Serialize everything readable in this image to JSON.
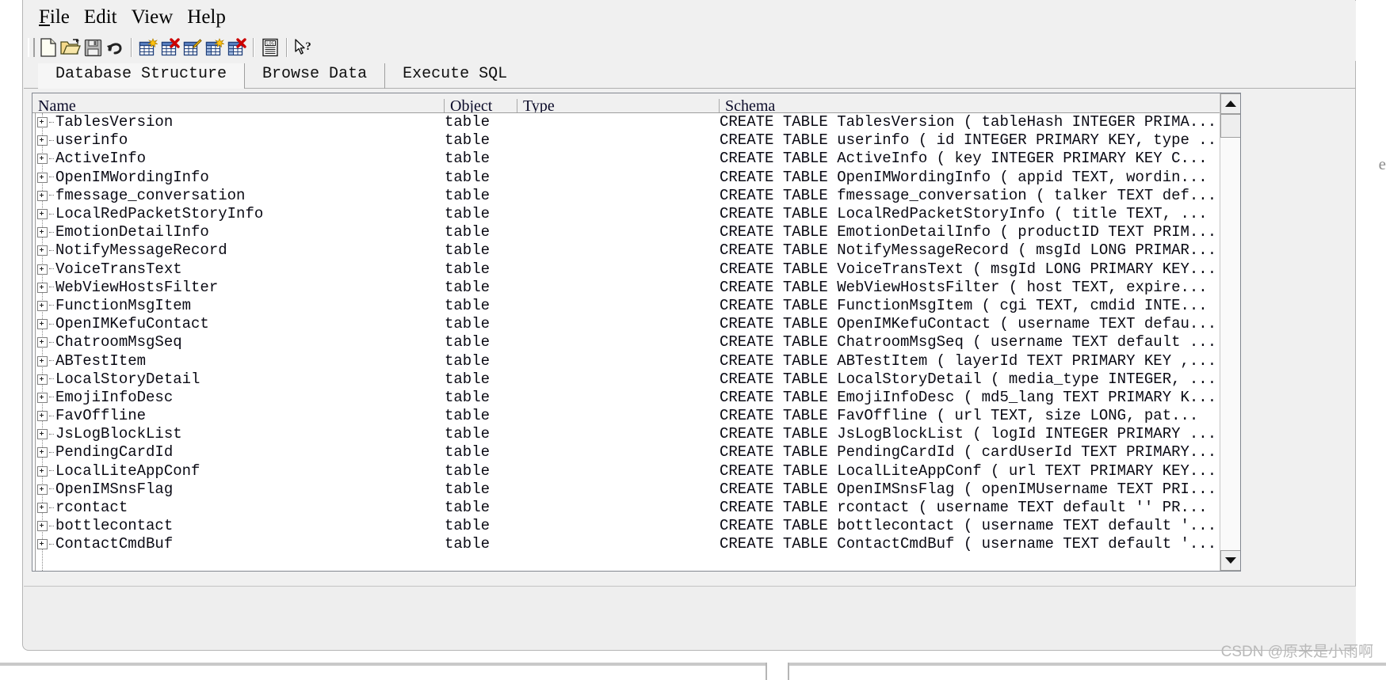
{
  "window": {
    "title_bleed": "aaaaaa aaaaa aaa",
    "right_edge_bleed": "e"
  },
  "menubar": {
    "items": [
      {
        "name": "file-menu",
        "mnemonic": "F",
        "rest": "ile"
      },
      {
        "name": "edit-menu",
        "mnemonic": "E",
        "rest": "dit"
      },
      {
        "name": "view-menu",
        "mnemonic": "V",
        "rest": "iew"
      },
      {
        "name": "help-menu",
        "mnemonic": "H",
        "rest": "elp"
      }
    ]
  },
  "toolbar": {
    "buttons": [
      {
        "icon": "new-database-icon",
        "label": "New Database"
      },
      {
        "icon": "open-database-icon",
        "label": "Open Database"
      },
      {
        "icon": "save-icon",
        "label": "Write Changes"
      },
      {
        "icon": "undo-icon",
        "label": "Revert Changes"
      },
      {
        "icon": "create-table-icon",
        "label": "Create Table"
      },
      {
        "icon": "delete-table-icon",
        "label": "Delete Table"
      },
      {
        "icon": "modify-table-icon",
        "label": "Modify Table"
      },
      {
        "icon": "create-index-icon",
        "label": "Create Index"
      },
      {
        "icon": "delete-index-icon",
        "label": "Delete Index"
      },
      {
        "icon": "log-icon",
        "label": "SQL Log"
      },
      {
        "icon": "whats-this-icon",
        "label": "What's This?"
      }
    ]
  },
  "tabs": [
    {
      "label": "Database Structure",
      "active": true
    },
    {
      "label": "Browse Data",
      "active": false
    },
    {
      "label": "Execute SQL",
      "active": false
    }
  ],
  "table": {
    "columns": [
      "Name",
      "Object",
      "Type",
      "Schema"
    ],
    "rows": [
      {
        "name": "TablesVersion",
        "object": "table",
        "type": "",
        "schema": "CREATE TABLE TablesVersion (  tableHash INTEGER PRIMA..."
      },
      {
        "name": "userinfo",
        "object": "table",
        "type": "",
        "schema": "CREATE TABLE userinfo ( id INTEGER PRIMARY KEY, type ..."
      },
      {
        "name": "ActiveInfo",
        "object": "table",
        "type": "",
        "schema": "CREATE TABLE ActiveInfo (  key INTEGER PRIMARY KEY  C..."
      },
      {
        "name": "OpenIMWordingInfo",
        "object": "table",
        "type": "",
        "schema": "CREATE TABLE OpenIMWordingInfo (  appid TEXT,  wordin..."
      },
      {
        "name": "fmessage_conversation",
        "object": "table",
        "type": "",
        "schema": "CREATE TABLE fmessage_conversation (  talker TEXT def..."
      },
      {
        "name": "LocalRedPacketStoryInfo",
        "object": "table",
        "type": "",
        "schema": "CREATE TABLE LocalRedPacketStoryInfo (  title TEXT,  ..."
      },
      {
        "name": "EmotionDetailInfo",
        "object": "table",
        "type": "",
        "schema": "CREATE TABLE EmotionDetailInfo (  productID TEXT PRIM..."
      },
      {
        "name": "NotifyMessageRecord",
        "object": "table",
        "type": "",
        "schema": "CREATE TABLE NotifyMessageRecord (  msgId LONG PRIMAR..."
      },
      {
        "name": "VoiceTransText",
        "object": "table",
        "type": "",
        "schema": "CREATE TABLE VoiceTransText (  msgId LONG PRIMARY KEY..."
      },
      {
        "name": "WebViewHostsFilter",
        "object": "table",
        "type": "",
        "schema": "CREATE TABLE WebViewHostsFilter (  host TEXT,  expire..."
      },
      {
        "name": "FunctionMsgItem",
        "object": "table",
        "type": "",
        "schema": "CREATE TABLE FunctionMsgItem (  cgi TEXT,   cmdid INTE..."
      },
      {
        "name": "OpenIMKefuContact",
        "object": "table",
        "type": "",
        "schema": "CREATE TABLE OpenIMKefuContact (  username TEXT defau..."
      },
      {
        "name": "ChatroomMsgSeq",
        "object": "table",
        "type": "",
        "schema": "CREATE TABLE ChatroomMsgSeq (  username TEXT default ..."
      },
      {
        "name": "ABTestItem",
        "object": "table",
        "type": "",
        "schema": "CREATE TABLE ABTestItem (  layerId TEXT PRIMARY KEY ,..."
      },
      {
        "name": "LocalStoryDetail",
        "object": "table",
        "type": "",
        "schema": "CREATE TABLE LocalStoryDetail (  media_type INTEGER, ..."
      },
      {
        "name": "EmojiInfoDesc",
        "object": "table",
        "type": "",
        "schema": "CREATE TABLE EmojiInfoDesc (  md5_lang TEXT PRIMARY K..."
      },
      {
        "name": "FavOffline",
        "object": "table",
        "type": "",
        "schema": "CREATE TABLE FavOffline (  url TEXT,  size LONG,   pat..."
      },
      {
        "name": "JsLogBlockList",
        "object": "table",
        "type": "",
        "schema": "CREATE TABLE JsLogBlockList (  logId INTEGER PRIMARY ..."
      },
      {
        "name": "PendingCardId",
        "object": "table",
        "type": "",
        "schema": "CREATE TABLE PendingCardId (  cardUserId TEXT PRIMARY..."
      },
      {
        "name": "LocalLiteAppConf",
        "object": "table",
        "type": "",
        "schema": "CREATE TABLE LocalLiteAppConf (  url TEXT PRIMARY KEY..."
      },
      {
        "name": "OpenIMSnsFlag",
        "object": "table",
        "type": "",
        "schema": "CREATE TABLE OpenIMSnsFlag (  openIMUsername TEXT PRI..."
      },
      {
        "name": "rcontact",
        "object": "table",
        "type": "",
        "schema": "CREATE TABLE rcontact (  username TEXT default ''   PR..."
      },
      {
        "name": "bottlecontact",
        "object": "table",
        "type": "",
        "schema": "CREATE TABLE bottlecontact (  username TEXT default '..."
      },
      {
        "name": "ContactCmdBuf",
        "object": "table",
        "type": "",
        "schema": "CREATE TABLE ContactCmdBuf (  username TEXT default '..."
      }
    ],
    "partial_row": {
      "name": "",
      "object": "table",
      "type": "",
      "schema": ""
    }
  },
  "scrollbar": {
    "up_arrow": "scroll-up",
    "down_arrow": "scroll-down",
    "thumb_position_pct": 2
  },
  "watermark": {
    "text": "CSDN @原来是小雨啊"
  },
  "colors": {
    "window_bg": "#f0f0f0",
    "table_bg": "#ffffff",
    "header_bg": "#f0f0f0",
    "text": "#0a0a14",
    "border": "#828790",
    "watermark": "#b9b9b9"
  }
}
